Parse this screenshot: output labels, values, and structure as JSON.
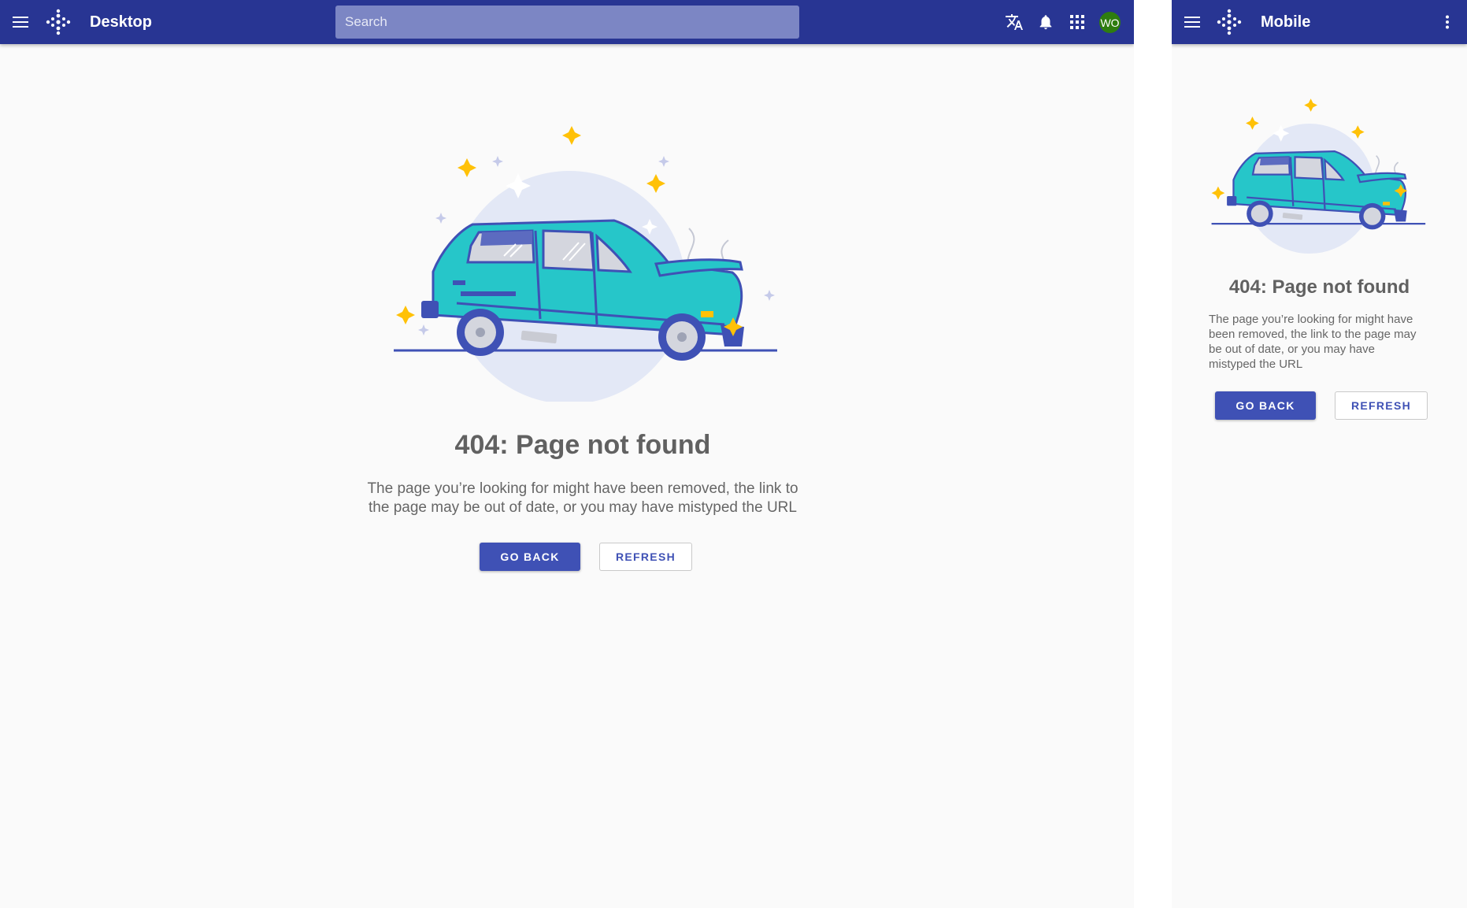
{
  "colors": {
    "appbar": "#283593",
    "primary": "#3f51b5",
    "search_bg": "#7c86c4",
    "avatar_bg": "#2e7d0f",
    "car": "#26c6c9",
    "accent_star": "#ffc107"
  },
  "desktop": {
    "app_title": "Desktop",
    "search": {
      "placeholder": "Search",
      "value": ""
    },
    "header_icons": [
      "menu-icon",
      "logo-icon",
      "translate-icon",
      "bell-icon",
      "apps-grid-icon"
    ],
    "avatar_initials": "WO",
    "error": {
      "title": "404: Page not found",
      "desc_line1": "The page you’re looking for might have been removed, the link to",
      "desc_line2": "the page may be out of date, or you may have mistyped the URL",
      "go_back": "GO BACK",
      "refresh": "REFRESH"
    }
  },
  "mobile": {
    "app_title": "Mobile",
    "header_icons": [
      "menu-icon",
      "logo-icon",
      "more-vert-icon"
    ],
    "error": {
      "title": "404: Page not found",
      "desc_line1": "The page you’re looking for might have",
      "desc_line2": "been removed, the link to the page may",
      "desc_line3": "be out of date, or you may have",
      "desc_line4": "mistyped the URL",
      "go_back": "GO BACK",
      "refresh": "REFRESH"
    }
  }
}
